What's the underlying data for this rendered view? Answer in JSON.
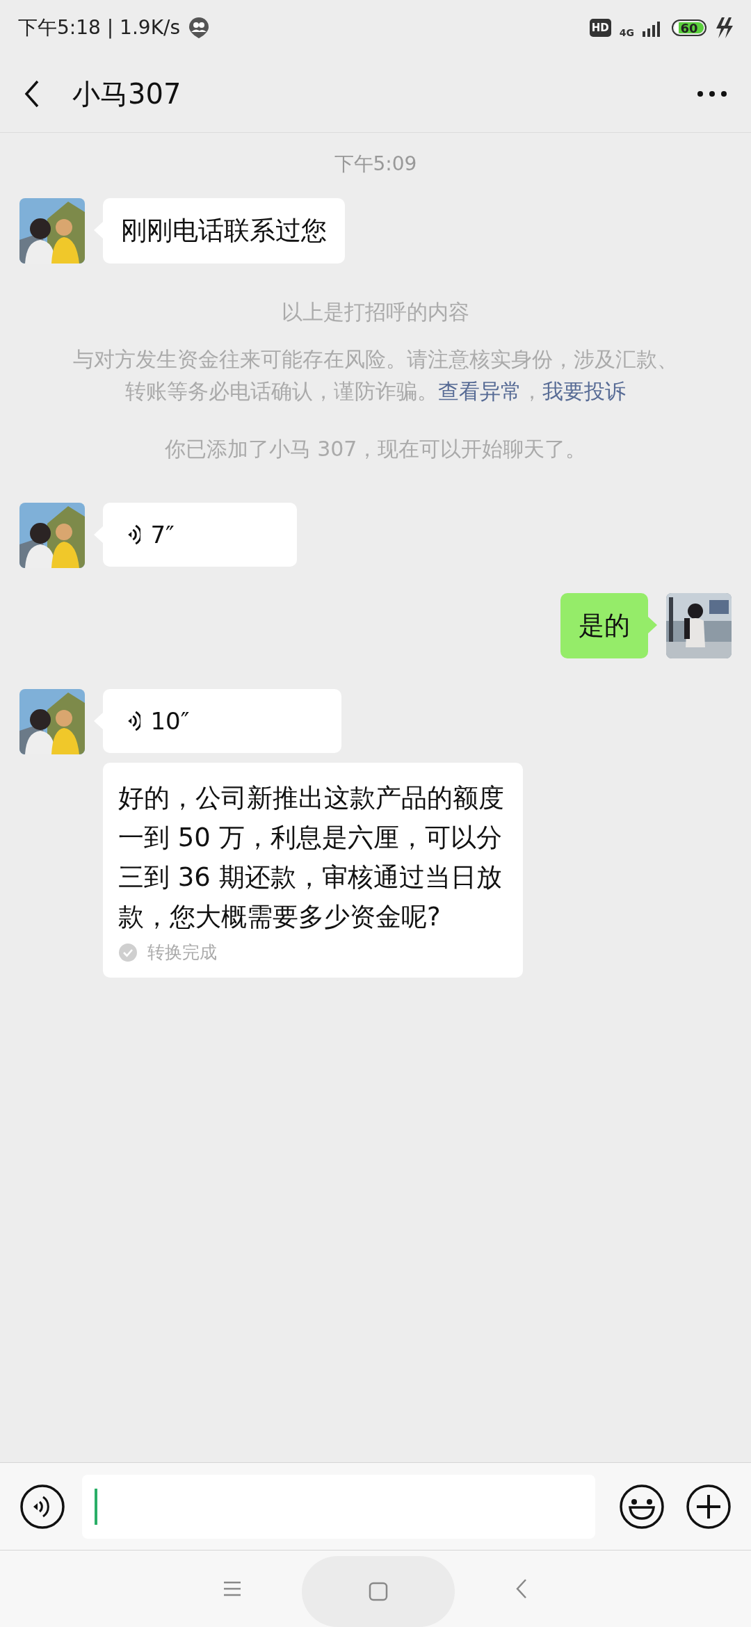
{
  "status_bar": {
    "time_speed": "下午5:18 | 1.9K/s",
    "hd": "HD",
    "network": "4G",
    "battery": "60"
  },
  "header": {
    "title": "小马307"
  },
  "messages": [
    {
      "kind": "time",
      "text": "下午5:09"
    },
    {
      "kind": "text",
      "outgoing": false,
      "text": "刚刚电话联系过您"
    },
    {
      "kind": "notice",
      "text": "以上是打招呼的内容"
    },
    {
      "kind": "warning",
      "text": "与对方发生资金往来可能存在风险。请注意核实身份，涉及汇款、转账等务必电话确认，谨防诈骗。",
      "links": [
        "查看异常",
        "我要投诉"
      ],
      "link_separator": "，"
    },
    {
      "kind": "notice",
      "text": "你已添加了小马 307，现在可以开始聊天了。"
    },
    {
      "kind": "voice",
      "outgoing": false,
      "duration": "7″"
    },
    {
      "kind": "text",
      "outgoing": true,
      "text": "是的"
    },
    {
      "kind": "voice",
      "outgoing": false,
      "duration": "10″",
      "transcript": {
        "text": "好的，公司新推出这款产品的额度一到 50 万，利息是六厘，可以分三到 36 期还款，审核通过当日放款，您大概需要多少资金呢?",
        "status": "转换完成"
      }
    }
  ]
}
